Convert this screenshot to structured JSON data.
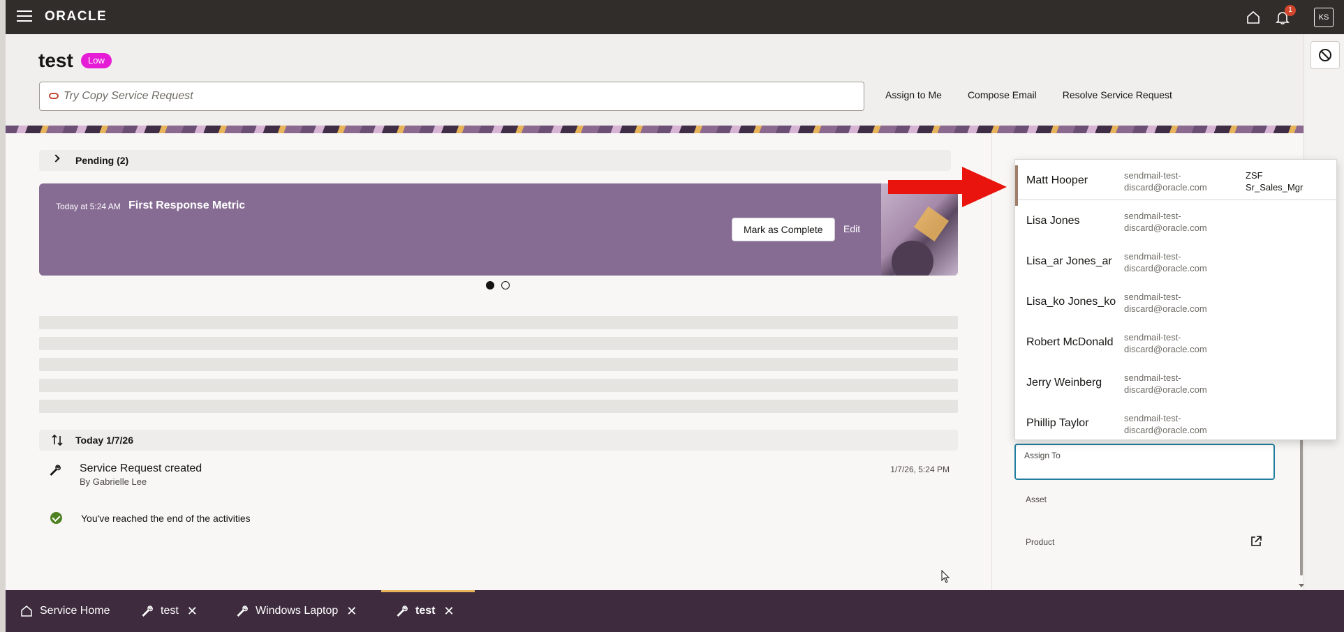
{
  "topbar": {
    "logo": "ORACLE",
    "notification_count": "1",
    "avatar_initials": "KS"
  },
  "header": {
    "title": "test",
    "priority": "Low",
    "search_placeholder": "Try Copy Service Request",
    "actions": [
      "Assign to Me",
      "Compose Email",
      "Resolve Service Request"
    ]
  },
  "pending": {
    "label": "Pending (2)"
  },
  "metric": {
    "time": "Today at 5:24 AM",
    "title": "First Response Metric",
    "complete_label": "Mark as Complete",
    "edit_label": "Edit"
  },
  "timeline": {
    "date_label": "Today 1/7/26",
    "activity_title": "Service Request created",
    "activity_by": "By Gabrielle Lee",
    "activity_time": "1/7/26, 5:24 PM",
    "end_message": "You've reached the end of the activities"
  },
  "side": {
    "assign_label": "Assign To",
    "asset_label": "Asset",
    "product_label": "Product"
  },
  "dropdown": {
    "items": [
      {
        "name": "Matt Hooper",
        "email1": "sendmail-test-",
        "email2": "discard@oracle.com",
        "role1": "ZSF",
        "role2": "Sr_Sales_Mgr"
      },
      {
        "name": "Lisa Jones",
        "email1": "sendmail-test-",
        "email2": "discard@oracle.com",
        "role1": "",
        "role2": ""
      },
      {
        "name": "Lisa_ar Jones_ar",
        "email1": "sendmail-test-",
        "email2": "discard@oracle.com",
        "role1": "",
        "role2": ""
      },
      {
        "name": "Lisa_ko Jones_ko",
        "email1": "sendmail-test-",
        "email2": "discard@oracle.com",
        "role1": "",
        "role2": ""
      },
      {
        "name": "Robert McDonald",
        "email1": "sendmail-test-",
        "email2": "discard@oracle.com",
        "role1": "",
        "role2": ""
      },
      {
        "name": "Jerry Weinberg",
        "email1": "sendmail-test-",
        "email2": "discard@oracle.com",
        "role1": "",
        "role2": ""
      },
      {
        "name": "Phillip Taylor",
        "email1": "sendmail-test-",
        "email2": "discard@oracle.com",
        "role1": "",
        "role2": ""
      }
    ]
  },
  "tabs": [
    {
      "label": "Service Home",
      "icon": "home-icon",
      "closable": false
    },
    {
      "label": "test",
      "icon": "wrench-icon",
      "closable": true
    },
    {
      "label": "Windows Laptop",
      "icon": "wrench-icon",
      "closable": true
    },
    {
      "label": "test",
      "icon": "wrench-icon",
      "closable": true,
      "active": true
    }
  ],
  "colors": {
    "topbar": "#312d2a",
    "priority_badge": "#e51bd6",
    "metric_card": "#866b93",
    "tabbar": "#3e2c3e",
    "active_tab_indicator": "#e7b35b",
    "focus_border": "#227e9e",
    "annotation_arrow": "#e8140d"
  }
}
